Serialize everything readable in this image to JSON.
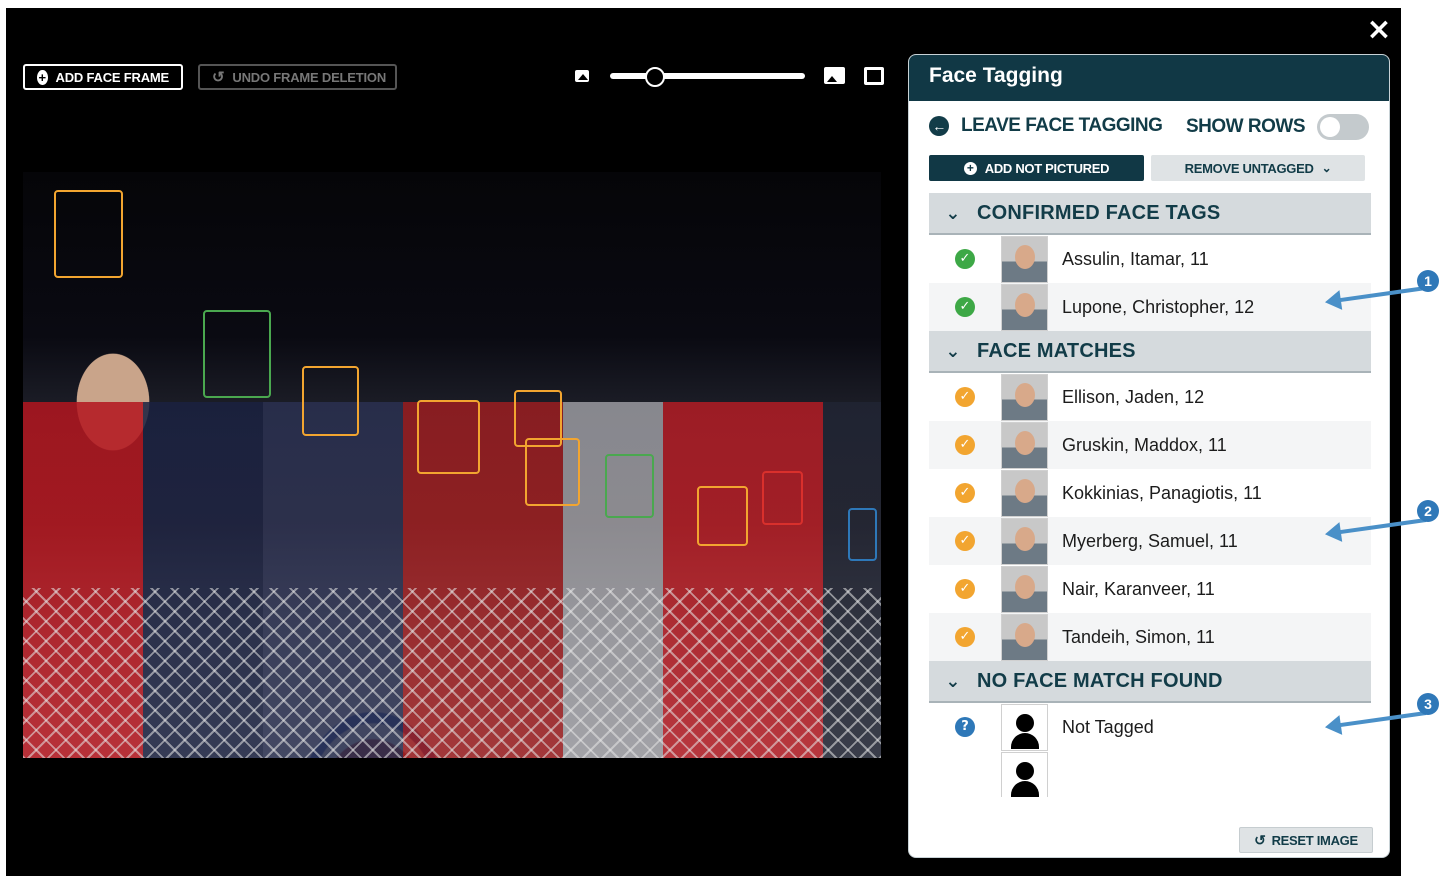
{
  "viewer": {
    "close_icon": "×",
    "add_face_frame": "ADD FACE FRAME",
    "undo_frame_deletion": "UNDO FRAME DELETION",
    "zoom_level": 0.2
  },
  "panel": {
    "title": "Face Tagging",
    "leave_label": "LEAVE FACE TAGGING",
    "show_rows_label": "SHOW ROWS",
    "show_rows_on": false,
    "add_not_pictured": "ADD NOT PICTURED",
    "remove_untagged": "REMOVE UNTAGGED",
    "reset_image": "RESET IMAGE",
    "sections": [
      {
        "title": "CONFIRMED FACE TAGS",
        "rows": [
          {
            "status": "confirmed",
            "name": "Assulin, Itamar, 11"
          },
          {
            "status": "confirmed",
            "name": "Lupone, Christopher, 12"
          }
        ]
      },
      {
        "title": "FACE MATCHES",
        "rows": [
          {
            "status": "match",
            "name": "Ellison, Jaden, 12"
          },
          {
            "status": "match",
            "name": "Gruskin, Maddox, 11"
          },
          {
            "status": "match",
            "name": "Kokkinias, Panagiotis, 11"
          },
          {
            "status": "match",
            "name": "Myerberg, Samuel, 11"
          },
          {
            "status": "match",
            "name": "Nair, Karanveer, 11"
          },
          {
            "status": "match",
            "name": "Tandeih, Simon, 11"
          }
        ]
      },
      {
        "title": "NO FACE MATCH FOUND",
        "rows": [
          {
            "status": "unknown",
            "name": "Not Tagged"
          }
        ]
      }
    ]
  },
  "annotations": [
    "1",
    "2",
    "3"
  ],
  "colors": {
    "face_confirmed": "#4aa84f",
    "face_match": "#f2a530",
    "face_rejected": "#d9302c",
    "face_unknown": "#2e78b8",
    "panel_header": "#113845"
  }
}
